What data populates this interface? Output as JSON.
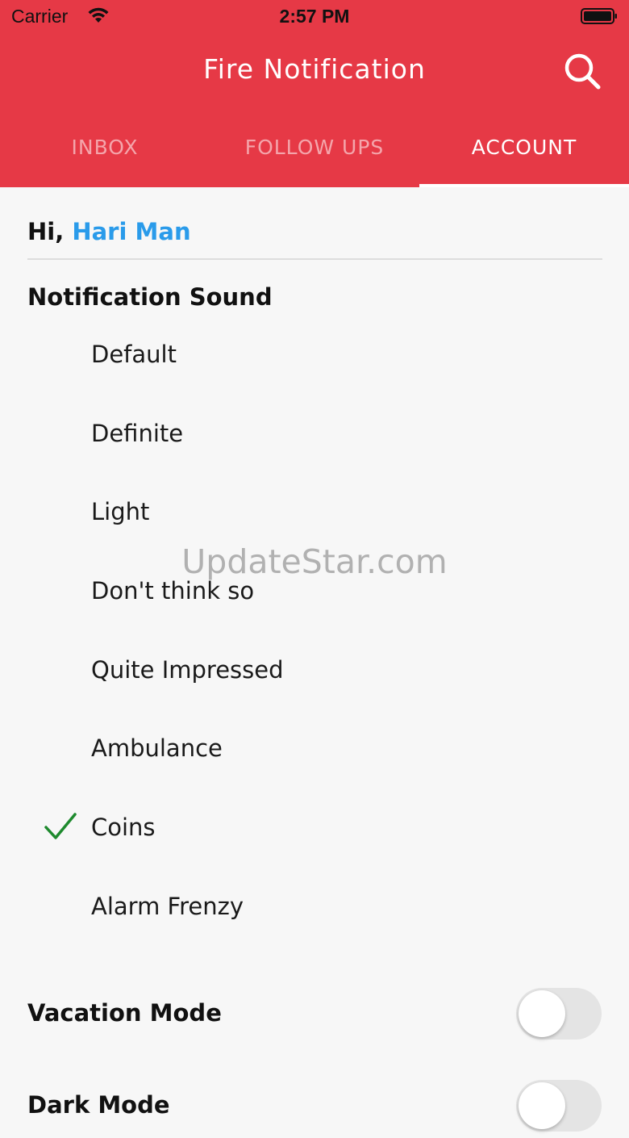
{
  "status_bar": {
    "carrier": "Carrier",
    "time": "2:57 PM"
  },
  "header": {
    "title": "Fire Notification",
    "background_color": "#e63946",
    "search_icon": "search-icon"
  },
  "tabs": [
    {
      "label": "INBOX",
      "active": false
    },
    {
      "label": "FOLLOW UPS",
      "active": false
    },
    {
      "label": "ACCOUNT",
      "active": true
    }
  ],
  "account": {
    "greeting_prefix": "Hi,",
    "user_name": "Hari Man",
    "user_name_color": "#2a9bea"
  },
  "notification_sound": {
    "title": "Notification Sound",
    "options": [
      {
        "label": "Default",
        "selected": false
      },
      {
        "label": "Definite",
        "selected": false
      },
      {
        "label": "Light",
        "selected": false
      },
      {
        "label": "Don't think so",
        "selected": false
      },
      {
        "label": "Quite Impressed",
        "selected": false
      },
      {
        "label": "Ambulance",
        "selected": false
      },
      {
        "label": "Coins",
        "selected": true
      },
      {
        "label": "Alarm Frenzy",
        "selected": false
      }
    ],
    "check_color": "#1e8a2e"
  },
  "settings": {
    "vacation_mode": {
      "label": "Vacation Mode",
      "on": false
    },
    "dark_mode": {
      "label": "Dark Mode",
      "on": false
    }
  },
  "watermark": "UpdateStar.com"
}
